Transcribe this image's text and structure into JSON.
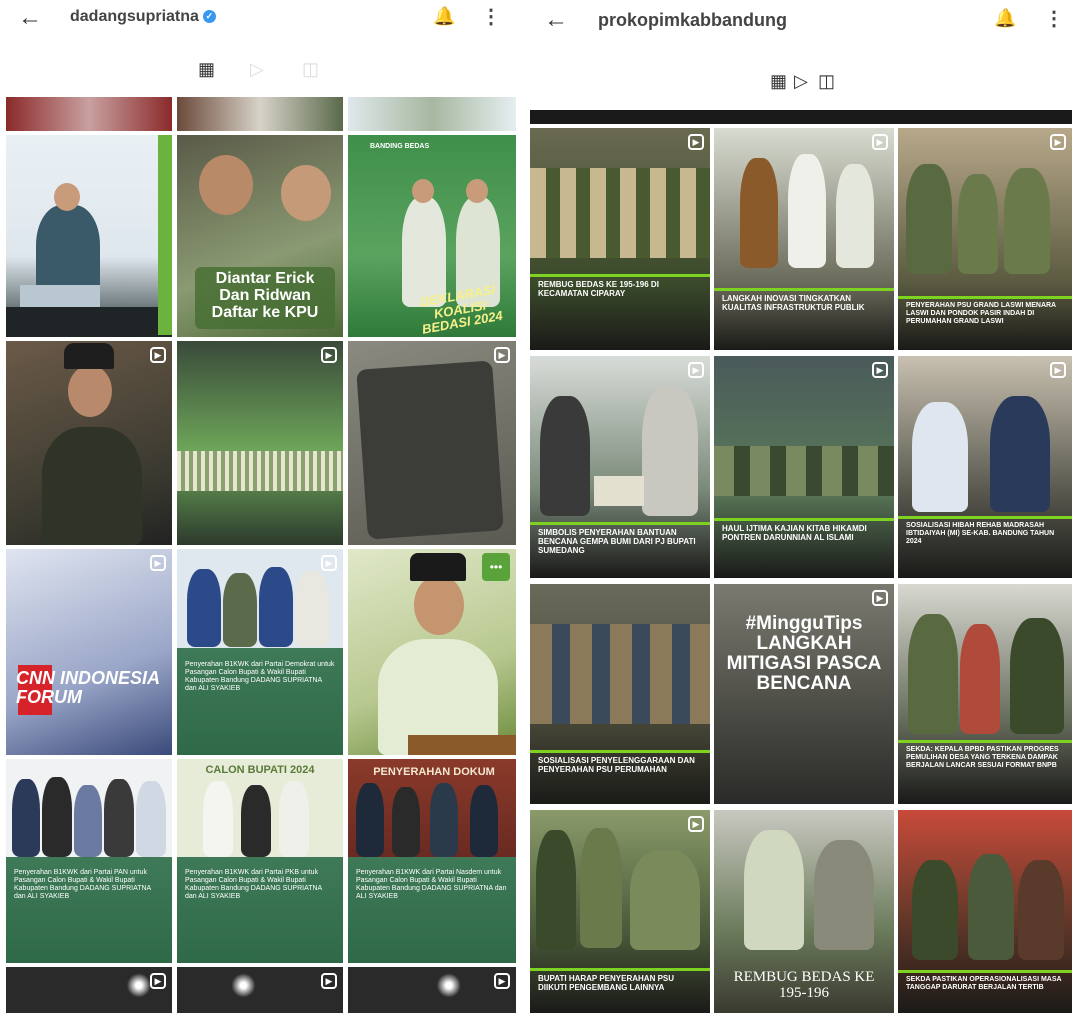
{
  "left": {
    "back_icon": "arrow-left",
    "username": "dadangsupriatna",
    "verified": "✓",
    "bell_icon": "bell-icon",
    "tabs": {
      "grid": "▦",
      "reels": "▷",
      "tagged": "◫"
    },
    "posts": [
      {
        "text": "Diantar Erick Dan Ridwan Daftar ke KPU"
      },
      {
        "text": "DEKLARASI KOALISI BEDASI 2024"
      },
      {
        "text": "BANDING BEDAS"
      },
      {
        "text": "CNN INDONESIA FORUM"
      },
      {
        "text": "Penyerahan B1KWK dari Partai Demokrat untuk Pasangan Calon Bupati & Wakil Bupati Kabupaten Bandung DADANG SUPRIATNA dan ALI SYAKIEB"
      },
      {
        "text": "Penyerahan B1KWK dari Partai PAN untuk Pasangan Calon Bupati & Wakil Bupati Kabupaten Bandung DADANG SUPRIATNA dan ALI SYAKIEB"
      },
      {
        "text": "Penyerahan B1KWK dari Partai PKB untuk Pasangan Calon Bupati & Wakil Bupati Kabupaten Bandung DADANG SUPRIATNA dan ALI SYAKIEB"
      },
      {
        "text": "Penyerahan B1KWK dari Partai Nasdem untuk Pasangan Calon Bupati & Wakil Bupati Kabupaten Bandung DADANG SUPRIATNA dan ALI SYAKIEB"
      },
      {
        "text": "PENYERAHAN DOKUM"
      },
      {
        "text": "CALON BUPATI 2024"
      }
    ]
  },
  "right": {
    "back_icon": "arrow-left",
    "username": "prokopimkabbandung",
    "bell_icon": "bell-icon",
    "tabs": {
      "grid": "▦",
      "reels": "▷",
      "tagged": "◫"
    },
    "posts": [
      {
        "caption": "REMBUG BEDAS KE 195-196 DI KECAMATAN CIPARAY"
      },
      {
        "caption": "LANGKAH INOVASI TINGKATKAN KUALITAS INFRASTRUKTUR PUBLIK"
      },
      {
        "caption": "PENYERAHAN PSU GRAND LASWI MENARA LASWI DAN PONDOK PASIR INDAH DI PERUMAHAN GRAND LASWI"
      },
      {
        "caption": "SIMBOLIS PENYERAHAN BANTUAN BENCANA GEMPA BUMI DARI PJ BUPATI SUMEDANG"
      },
      {
        "caption": "HAUL IJTIMA KAJIAN KITAB HIKAMDI PONTREN DARUNNIAN AL ISLAMI"
      },
      {
        "caption": "SOSIALISASI HIBAH REHAB MADRASAH IBTIDAIYAH (MI) SE-KAB. BANDUNG TAHUN 2024"
      },
      {
        "caption": "SOSIALISASI PENYELENGGARAAN DAN PENYERAHAN PSU PERUMAHAN"
      },
      {
        "caption": "#MingguTips LANGKAH MITIGASI PASCA BENCANA"
      },
      {
        "caption": "SEKDA: KEPALA BPBD PASTIKAN PROGRES PEMULIHAN DESA YANG TERKENA DAMPAK BERJALAN LANCAR SESUAI FORMAT BNPB"
      },
      {
        "caption": "BUPATI HARAP PENYERAHAN PSU DIIKUTI PENGEMBANG LAINNYA"
      },
      {
        "caption": "REMBUG BEDAS KE 195-196"
      },
      {
        "caption": "SEKDA PASTIKAN OPERASIONALISASI MASA TANGGAP DARURAT BERJALAN TERTIB"
      }
    ]
  },
  "colors": {
    "accent_green": "#7ed321",
    "verified_blue": "#3897f0"
  }
}
